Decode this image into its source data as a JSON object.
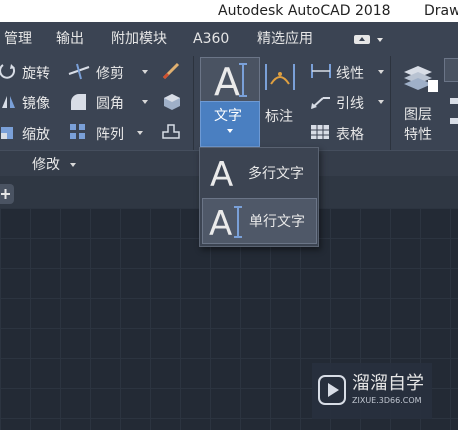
{
  "title_bar": {
    "app_title": "Autodesk AutoCAD 2018",
    "doc_title_partial": "Draw"
  },
  "tabs": [
    {
      "label": "管理"
    },
    {
      "label": "输出"
    },
    {
      "label": "附加模块"
    },
    {
      "label": "A360"
    },
    {
      "label": "精选应用"
    }
  ],
  "modify_panel": {
    "rows": [
      [
        {
          "label": "旋转"
        },
        {
          "label": "修剪"
        }
      ],
      [
        {
          "label": "镜像"
        },
        {
          "label": "圆角"
        }
      ],
      [
        {
          "label": "缩放"
        },
        {
          "label": "阵列"
        }
      ]
    ],
    "footer_label": "修改"
  },
  "annotation_panel": {
    "text_button": "文字",
    "dimension_button": "标注",
    "linear_label": "线性",
    "leader_label": "引线",
    "table_label": "表格"
  },
  "layers_panel": {
    "layer_props_line1": "图层",
    "layer_props_line2": "特性"
  },
  "text_dropdown": {
    "items": [
      {
        "label": "多行文字",
        "selected": false
      },
      {
        "label": "单行文字",
        "selected": true
      }
    ]
  },
  "watermark": {
    "brand": "溜溜自学",
    "url": "ZIXUE.3D66.COM"
  },
  "colors": {
    "ribbon": "#3b4453",
    "canvas": "#232a35",
    "accent": "#4a7fc1"
  }
}
